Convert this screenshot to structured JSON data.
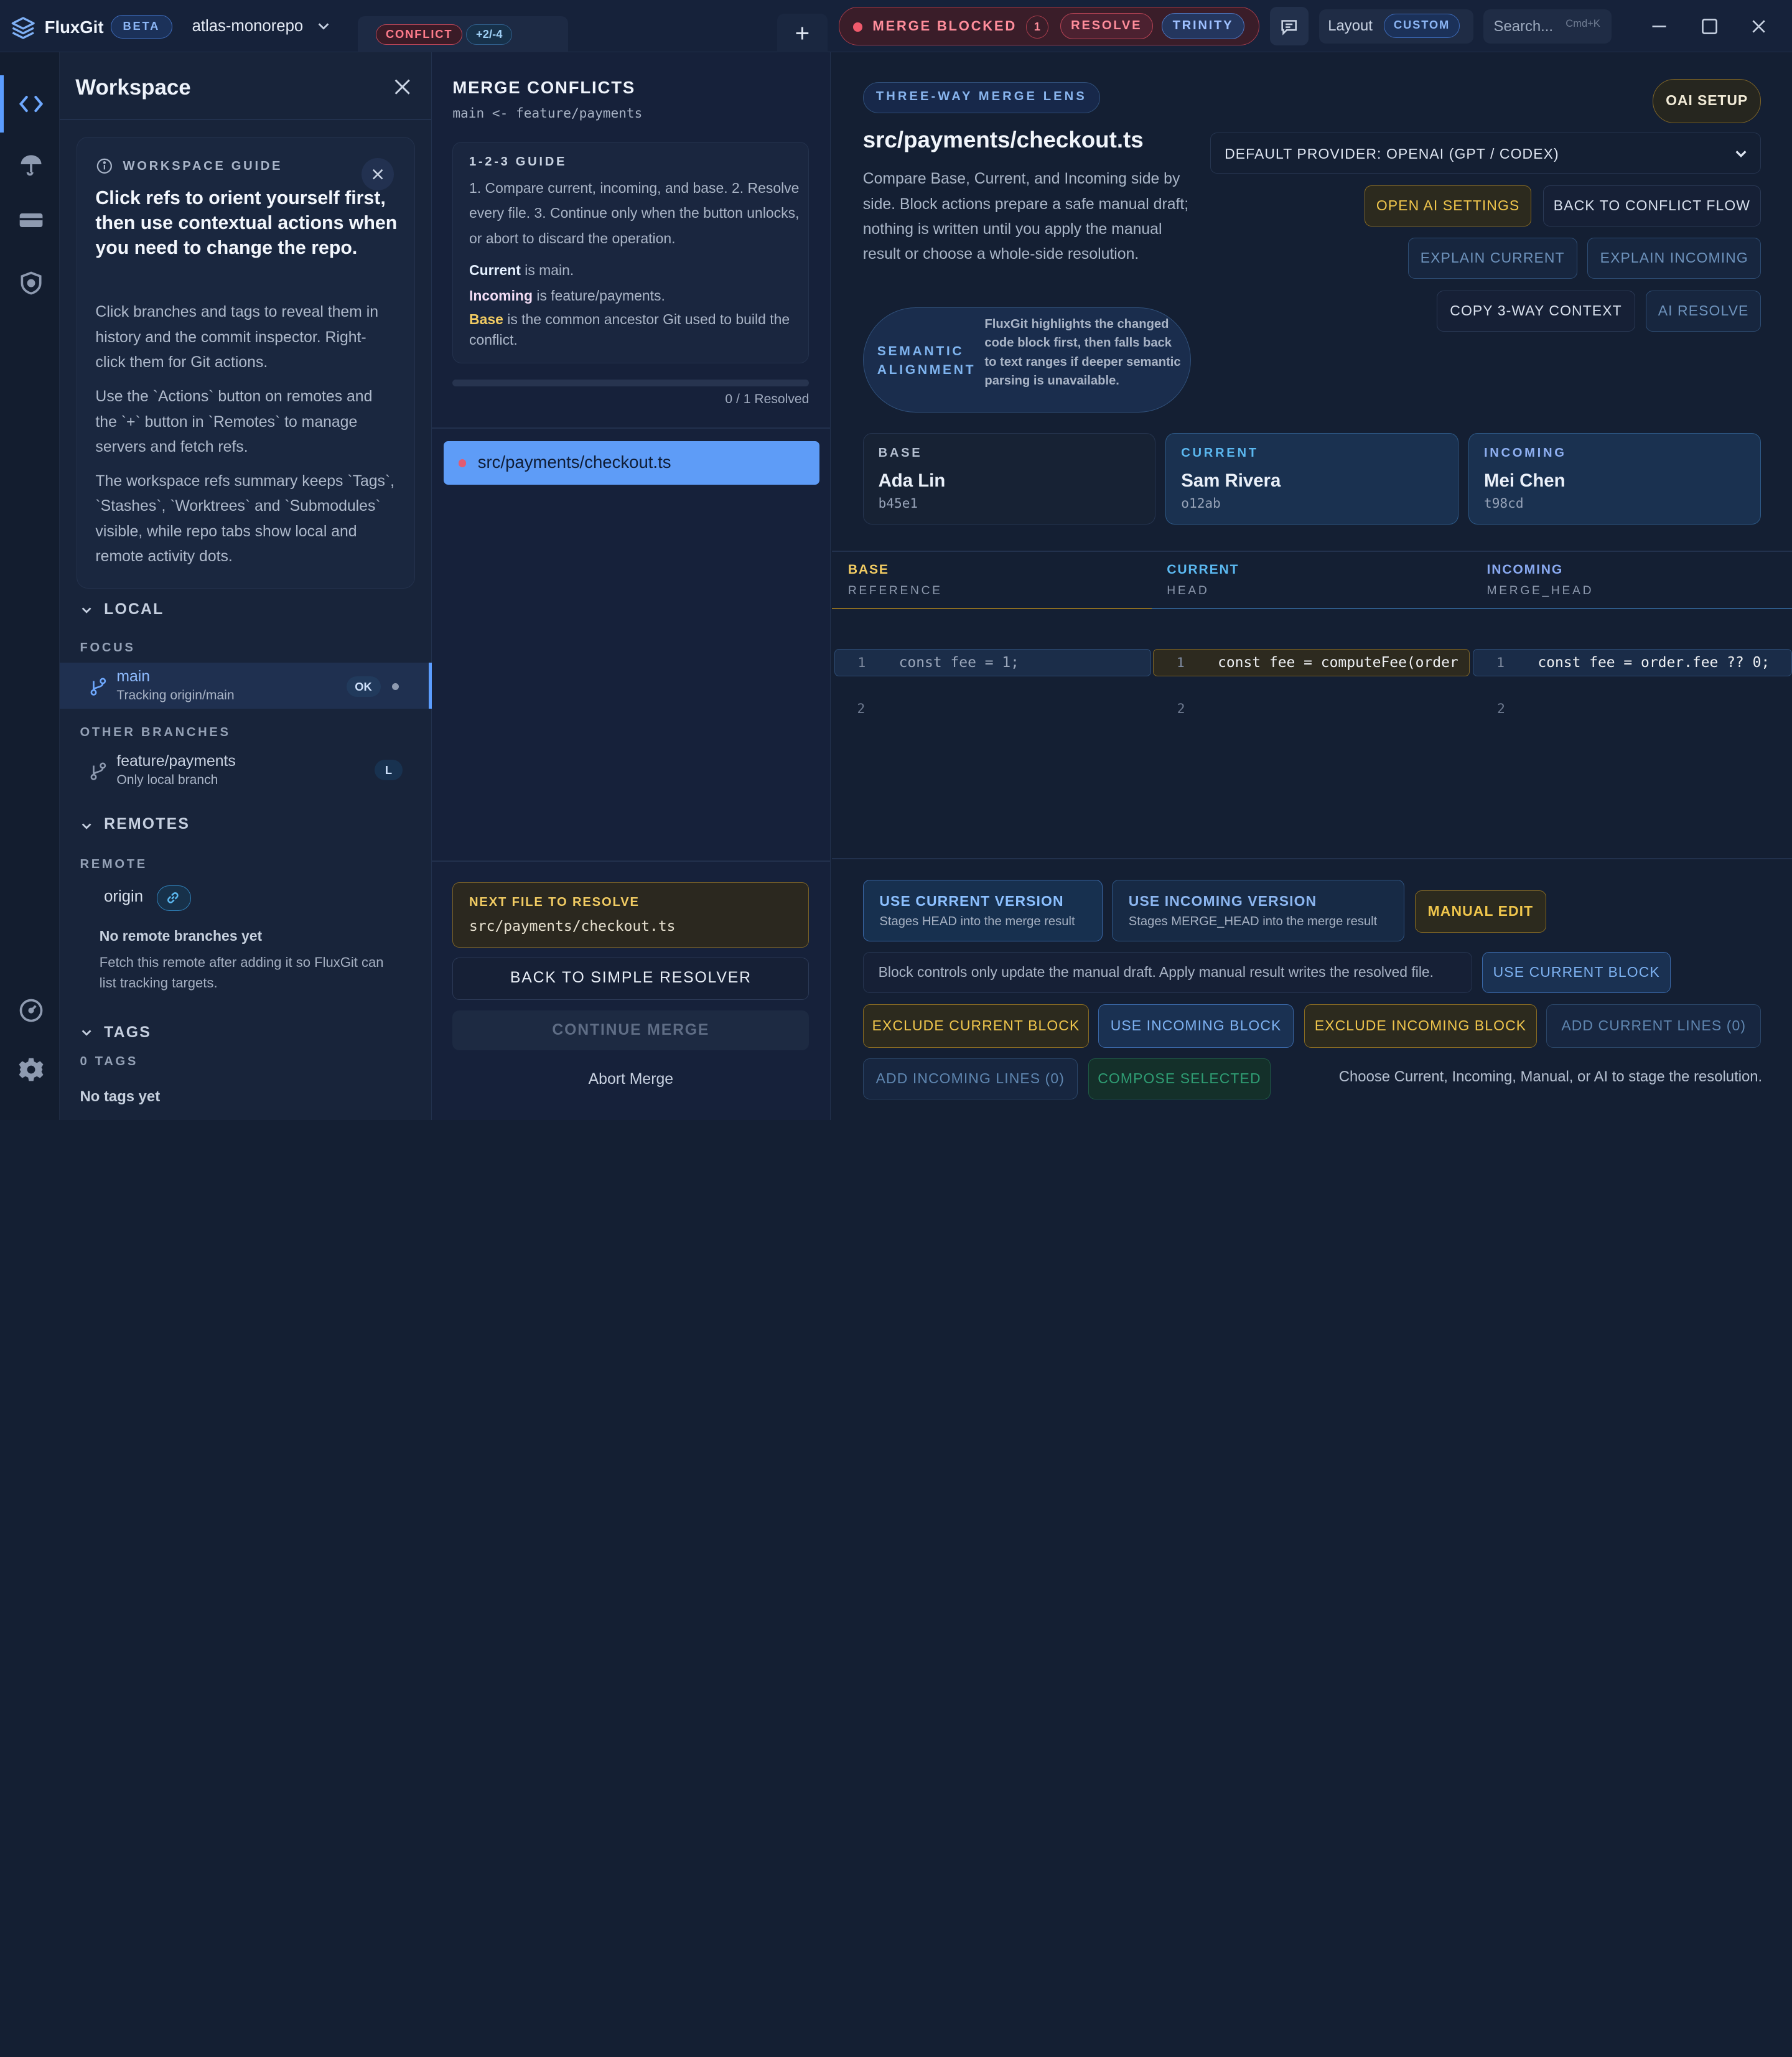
{
  "app": {
    "brand": "FluxGit",
    "beta": "BETA",
    "repo": "atlas-monorepo",
    "tab": {
      "conflict": "CONFLICT",
      "diff": "+2/-4"
    },
    "new_tab": "+"
  },
  "banner": {
    "text": "MERGE BLOCKED",
    "count": "1",
    "resolve": "RESOLVE",
    "trinity": "TRINITY"
  },
  "layout": {
    "label": "Layout",
    "value": "CUSTOM"
  },
  "search": {
    "placeholder": "Search...",
    "shortcut": "Cmd+K"
  },
  "sidebar": {
    "title": "Workspace",
    "guide": {
      "label": "WORKSPACE GUIDE",
      "heading": "Click refs to orient yourself first, then use contextual actions when you need to change the repo.",
      "p1": "Click branches and tags to reveal them in history and the commit inspector. Right-click them for Git actions.",
      "p2": "Use the `Actions` button on remotes and the `+` button in `Remotes` to manage servers and fetch refs.",
      "p3": "The workspace refs summary keeps `Tags`, `Stashes`, `Worktrees` and `Submodules` visible, while repo tabs show local and remote activity dots."
    },
    "local": {
      "header": "LOCAL",
      "focus": "FOCUS",
      "main": {
        "name": "main",
        "sub": "Tracking origin/main",
        "badge": "OK"
      },
      "other": "OTHER BRANCHES",
      "feature": {
        "name": "feature/payments",
        "sub": "Only local branch",
        "badge": "L"
      }
    },
    "remotes": {
      "header": "REMOTES",
      "sub": "REMOTE",
      "name": "origin",
      "empty_title": "No remote branches yet",
      "empty_text": "Fetch this remote after adding it so FluxGit can list tracking targets."
    },
    "tags": {
      "header": "TAGS",
      "count": "0 TAGS",
      "empty_title": "No tags yet"
    }
  },
  "merge": {
    "title": "MERGE CONFLICTS",
    "branches": "main <- feature/payments",
    "guide": {
      "label": "1-2-3 GUIDE",
      "steps": "1. Compare current, incoming, and base. 2. Resolve every file. 3. Continue only when the button unlocks, or abort to discard the operation.",
      "current_key": "Current",
      "current_text": " is main.",
      "incoming_key": "Incoming",
      "incoming_text": " is feature/payments.",
      "base_key": "Base",
      "base_text": " is the common ancestor Git used to build the conflict."
    },
    "resolved": 0,
    "total": 1,
    "resolved_label": "0 / 1 Resolved",
    "file": "src/payments/checkout.ts",
    "next_label": "NEXT FILE TO RESOLVE",
    "next_file": "src/payments/checkout.ts",
    "back_simple": "BACK TO SIMPLE RESOLVER",
    "continue": "CONTINUE MERGE",
    "abort": "Abort Merge"
  },
  "lens": {
    "pill": "THREE-WAY MERGE LENS",
    "file": "src/payments/checkout.ts",
    "description": "Compare Base, Current, and Incoming side by side. Block actions prepare a safe manual draft; nothing is written until you apply the manual result or choose a whole-side resolution.",
    "semantic_label": "SEMANTIC ALIGNMENT",
    "semantic_text": "FluxGit highlights the changed code block first, then falls back to text ranges if deeper semantic parsing is unavailable.",
    "oai_setup": "OAI SETUP",
    "provider": "DEFAULT PROVIDER: OPENAI (GPT / CODEX)",
    "open_ai_settings": "OPEN AI SETTINGS",
    "back_conflict_flow": "BACK TO CONFLICT FLOW",
    "explain_current": "EXPLAIN CURRENT",
    "explain_incoming": "EXPLAIN INCOMING",
    "copy_context": "COPY 3-WAY CONTEXT",
    "ai_resolve": "AI RESOLVE"
  },
  "people": {
    "base": {
      "label": "BASE",
      "name": "Ada Lin",
      "sha": "b45e1"
    },
    "current": {
      "label": "CURRENT",
      "name": "Sam Rivera",
      "sha": "o12ab"
    },
    "incoming": {
      "label": "INCOMING",
      "name": "Mei Chen",
      "sha": "t98cd"
    }
  },
  "columns": {
    "base": {
      "title": "BASE",
      "sub": "REFERENCE"
    },
    "current": {
      "title": "CURRENT",
      "sub": "HEAD"
    },
    "incoming": {
      "title": "INCOMING",
      "sub": "MERGE_HEAD"
    }
  },
  "code": {
    "base": {
      "ln1": "1",
      "line": "const fee = 1;",
      "ln2": "2"
    },
    "current": {
      "ln1": "1",
      "line": "const fee = computeFee(order",
      "ln2": "2"
    },
    "incoming": {
      "ln1": "1",
      "line": "const fee = order.fee ?? 0;",
      "ln2": "2"
    }
  },
  "actions": {
    "use_current": {
      "title": "USE CURRENT VERSION",
      "sub": "Stages HEAD into the merge result"
    },
    "use_incoming": {
      "title": "USE INCOMING VERSION",
      "sub": "Stages MERGE_HEAD into the merge result"
    },
    "manual_edit": "MANUAL EDIT",
    "info": "Block controls only update the manual draft. Apply manual result writes the resolved file.",
    "use_current_block": "USE CURRENT BLOCK",
    "exclude_current_block": "EXCLUDE CURRENT BLOCK",
    "use_incoming_block": "USE INCOMING BLOCK",
    "exclude_incoming_block": "EXCLUDE INCOMING BLOCK",
    "add_current_lines": "ADD CURRENT LINES (0)",
    "add_incoming_lines": "ADD INCOMING LINES (0)",
    "compose_selected": "COMPOSE SELECTED",
    "footer": "Choose Current, Incoming, Manual, or AI to stage the resolution."
  },
  "colors": {
    "accent": "#5b9dff",
    "base": "#f2cc63",
    "current": "#5bb8f0",
    "incoming": "#89a9f0",
    "danger": "#f05a6c"
  }
}
